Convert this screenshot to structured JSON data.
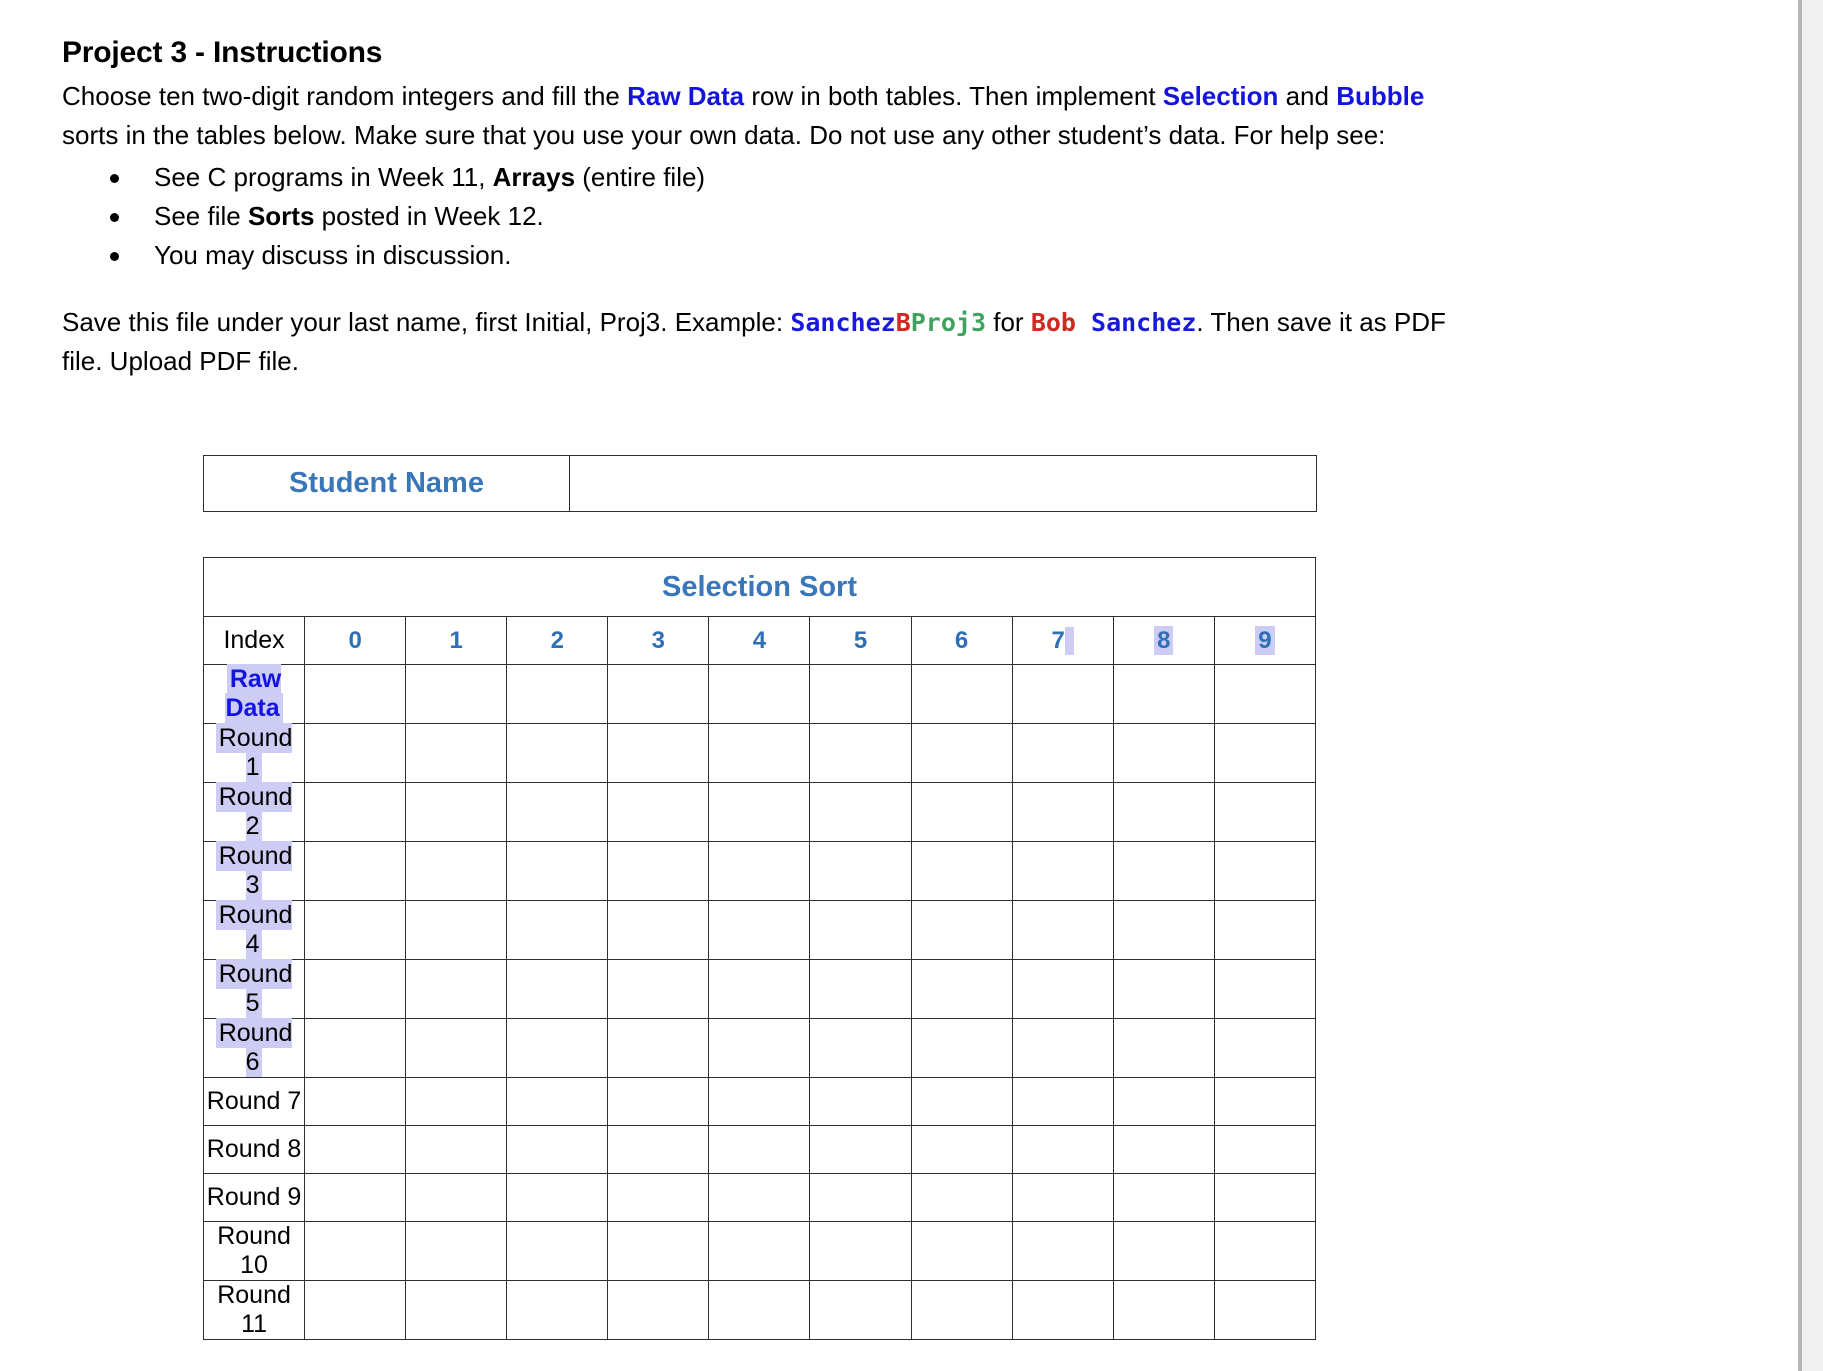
{
  "document": {
    "title": "Project 3 - Instructions",
    "paragraph1": {
      "part1": "Choose ten two-digit random integers and fill the ",
      "emph_raw_data": "Raw Data",
      "part2": " row in both tables. Then implement ",
      "emph_selection": "Selection",
      "part3": " and ",
      "emph_bubble": "Bubble",
      "part4": " sorts in the tables below. Make sure that you use your own data. Do not use any other student’s data. For help see:"
    },
    "bullets": [
      {
        "pre": "See C programs in Week 11, ",
        "bold": "Arrays",
        "post": " (entire file)"
      },
      {
        "pre": "See file ",
        "bold": "Sorts",
        "post": " posted in Week 12."
      },
      {
        "pre": "You may discuss in discussion.",
        "bold": "",
        "post": ""
      }
    ],
    "paragraph2": {
      "part1": "Save this file under your last name, first Initial, Proj3. Example: ",
      "example_last": "Sanchez",
      "example_initial": "B",
      "example_proj": "Proj3",
      "part2": " for ",
      "name_first": "Bob",
      "name_space": " ",
      "name_last": "Sanchez",
      "part3": ". Then save it as PDF file. Upload PDF file."
    }
  },
  "student_name_table": {
    "label": "Student Name",
    "value": ""
  },
  "selection_sort_table": {
    "title": "Selection Sort",
    "index_label": "Index",
    "index_columns": [
      "0",
      "1",
      "2",
      "3",
      "4",
      "5",
      "6",
      "7",
      "8",
      "9"
    ],
    "highlighted_index_columns": [
      "7",
      "8",
      "9"
    ],
    "rows": [
      {
        "label": "Raw Data",
        "highlighted": true,
        "blue_bold": true
      },
      {
        "label": "Round 1",
        "highlighted": true,
        "blue_bold": false
      },
      {
        "label": "Round 2",
        "highlighted": true,
        "blue_bold": false
      },
      {
        "label": "Round 3",
        "highlighted": true,
        "blue_bold": false
      },
      {
        "label": "Round 4",
        "highlighted": true,
        "blue_bold": false
      },
      {
        "label": "Round 5",
        "highlighted": true,
        "blue_bold": false
      },
      {
        "label": "Round 6",
        "highlighted": true,
        "blue_bold": false
      },
      {
        "label": "Round 7",
        "highlighted": false,
        "blue_bold": false
      },
      {
        "label": "Round 8",
        "highlighted": false,
        "blue_bold": false
      },
      {
        "label": "Round 9",
        "highlighted": false,
        "blue_bold": false
      },
      {
        "label": "Round 10",
        "highlighted": false,
        "blue_bold": false
      },
      {
        "label": "Round 11",
        "highlighted": false,
        "blue_bold": false
      }
    ]
  },
  "colors": {
    "heading_blue": "#3a76ba",
    "emphasis_blue": "#1414e0",
    "index_blue": "#2f6fb5",
    "selection_highlight": "#ccccf4",
    "example_blue": "#1919dd",
    "example_red": "#d02a22",
    "example_green": "#3fa35f",
    "table_border": "#2e2e2e"
  }
}
